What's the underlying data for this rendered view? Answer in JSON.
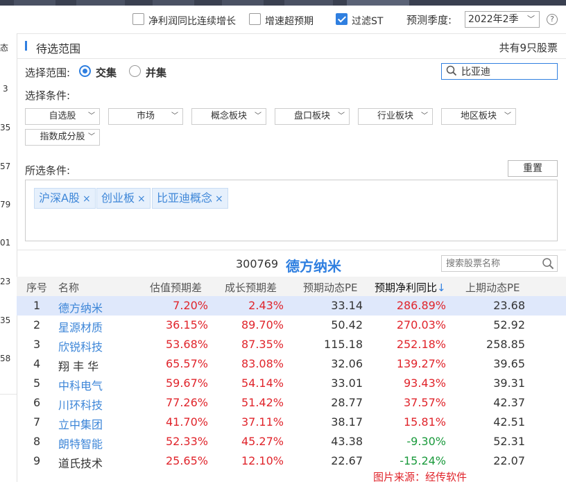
{
  "toolbar": {
    "checkboxes": [
      {
        "label": "净利润同比连续增长",
        "checked": false
      },
      {
        "label": "增速超预期",
        "checked": false
      },
      {
        "label": "过滤ST",
        "checked": true
      }
    ],
    "season_label": "预测季度:",
    "season_value": "2022年2季"
  },
  "left_column": {
    "items": [
      "态",
      "3",
      "35",
      "57",
      "79",
      "01",
      "23",
      "35",
      "58"
    ]
  },
  "panel": {
    "title": "待选范围",
    "count_text": "共有9只股票",
    "scope_label": "选择范围:",
    "scope_options": [
      {
        "label": "交集",
        "selected": true
      },
      {
        "label": "并集",
        "selected": false
      }
    ],
    "search_value": "比亚迪",
    "conditions_label": "选择条件:",
    "dropdowns": [
      "自选股",
      "市场",
      "概念板块",
      "盘口板块",
      "行业板块",
      "地区板块",
      "指数成分股"
    ],
    "selected_label": "所选条件:",
    "reset_label": "重置",
    "tags": [
      "沪深A股",
      "创业板",
      "比亚迪概念"
    ]
  },
  "stock": {
    "code": "300769",
    "name": "德方纳米",
    "search_placeholder": "搜索股票名称"
  },
  "table": {
    "headers": [
      "序号",
      "名称",
      "估值预期差",
      "成长预期差",
      "预期动态PE",
      "预期净利同比",
      "上期动态PE"
    ],
    "sort_arrow": "↓",
    "rows": [
      {
        "idx": "1",
        "name": "德方纳米",
        "est": "7.20%",
        "grow": "2.43%",
        "pe": "33.14",
        "net": "286.89%",
        "last": "23.68",
        "link": true,
        "net_sign": "pos"
      },
      {
        "idx": "2",
        "name": "星源材质",
        "est": "36.15%",
        "grow": "89.70%",
        "pe": "50.42",
        "net": "270.03%",
        "last": "52.92",
        "link": true,
        "net_sign": "pos"
      },
      {
        "idx": "3",
        "name": "欣锐科技",
        "est": "53.68%",
        "grow": "87.35%",
        "pe": "115.18",
        "net": "252.18%",
        "last": "258.85",
        "link": true,
        "net_sign": "pos"
      },
      {
        "idx": "4",
        "name": "翔 丰 华",
        "est": "65.57%",
        "grow": "83.08%",
        "pe": "32.06",
        "net": "139.27%",
        "last": "39.65",
        "link": false,
        "net_sign": "pos"
      },
      {
        "idx": "5",
        "name": "中科电气",
        "est": "59.67%",
        "grow": "54.14%",
        "pe": "33.01",
        "net": "93.43%",
        "last": "39.31",
        "link": true,
        "net_sign": "pos"
      },
      {
        "idx": "6",
        "name": "川环科技",
        "est": "77.26%",
        "grow": "51.42%",
        "pe": "28.77",
        "net": "37.57%",
        "last": "42.37",
        "link": true,
        "net_sign": "pos"
      },
      {
        "idx": "7",
        "name": "立中集团",
        "est": "41.70%",
        "grow": "37.11%",
        "pe": "38.17",
        "net": "15.81%",
        "last": "42.51",
        "link": true,
        "net_sign": "pos"
      },
      {
        "idx": "8",
        "name": "朗特智能",
        "est": "52.33%",
        "grow": "45.27%",
        "pe": "43.38",
        "net": "-9.30%",
        "last": "52.31",
        "link": true,
        "net_sign": "neg"
      },
      {
        "idx": "9",
        "name": "道氏技术",
        "est": "25.65%",
        "grow": "12.10%",
        "pe": "22.67",
        "net": "-15.24%",
        "last": "22.07",
        "link": false,
        "net_sign": "neg"
      }
    ]
  },
  "watermark": "图片来源：经传软件",
  "colors": {
    "accent": "#2f7fe0",
    "up": "#e0242b",
    "down": "#1a9a3c",
    "selected_row": "#dfe8fb"
  }
}
